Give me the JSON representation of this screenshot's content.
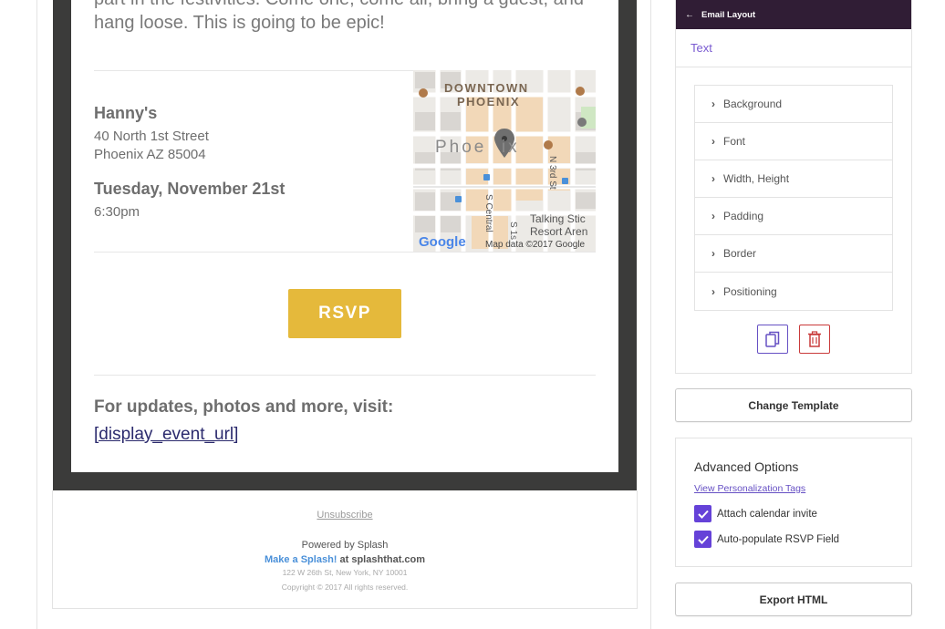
{
  "email": {
    "intro_line1": "part in the festivities. Come one, come all, bring a guest, and",
    "intro_line2": "hang loose. This is going to be epic!",
    "venue_name": "Hanny's",
    "address_line1": "40 North 1st Street",
    "address_line2": "Phoenix AZ 85004",
    "date": "Tuesday, November 21st",
    "time": "6:30pm",
    "map": {
      "label_downtown": "DOWNTOWN",
      "label_phoenix_upper": "PHOENIX",
      "label_phoenix": "Phoe  ix",
      "label_n3rd": "N 3rd St",
      "label_scentral": "S Central",
      "label_s1": "S 1s",
      "label_talking_stick_1": "Talking Stic",
      "label_talking_stick_2": "Resort Aren",
      "google": "Google",
      "map_data": "Map data ©2017 Google"
    },
    "rsvp_label": "RSVP",
    "updates_text": "For updates, photos and more, visit:",
    "event_url": "[display_event_url]"
  },
  "footer": {
    "unsubscribe": "Unsubscribe",
    "powered_by": "Powered by Splash",
    "make_a_splash": "Make a Splash!",
    "at_text": " at splashthat.com",
    "address": "122 W 26th St, New York, NY 10001",
    "copyright": "Copyright © 2017 All rights reserved."
  },
  "panel": {
    "header_title": "Email Layout",
    "back_icon": "arrow-left-icon",
    "section": "Text",
    "properties": [
      "Background",
      "Font",
      "Width, Height",
      "Padding",
      "Border",
      "Positioning"
    ],
    "copy_icon": "copy-icon",
    "trash_icon": "trash-icon"
  },
  "actions": {
    "change_template": "Change Template",
    "export_html": "Export HTML"
  },
  "advanced": {
    "title": "Advanced Options",
    "link": "View Personalization Tags",
    "options": [
      {
        "label": "Attach calendar invite",
        "checked": true
      },
      {
        "label": "Auto-populate RSVP Field",
        "checked": true
      }
    ]
  },
  "colors": {
    "accent": "#6542d8",
    "header_bg": "#301d35",
    "rsvp": "#e5b93b",
    "danger": "#c93a3a"
  }
}
